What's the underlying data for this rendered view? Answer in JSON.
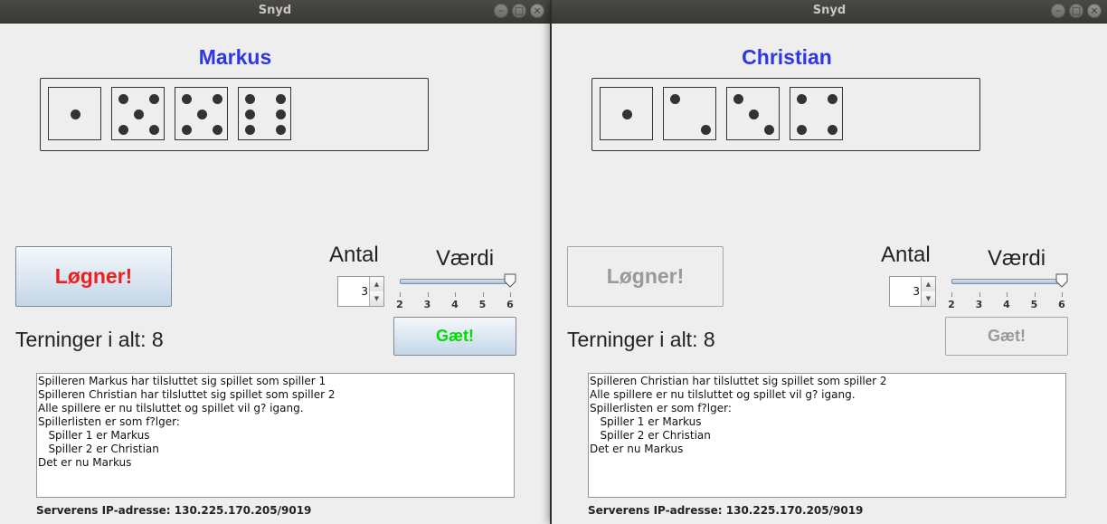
{
  "windows": [
    {
      "title": "Snyd",
      "player_name": "Markus",
      "dice": [
        1,
        5,
        5,
        6
      ],
      "liar_label": "Løgner!",
      "liar_enabled": true,
      "antal_label": "Antal",
      "antal_value": "3",
      "vaerdi_label": "Værdi",
      "slider_value": 6,
      "slider_ticks": [
        "2",
        "3",
        "4",
        "5",
        "6"
      ],
      "guess_label": "Gæt!",
      "guess_enabled": true,
      "total_dice_text": "Terninger i alt: 8",
      "log_lines": [
        "Spilleren Markus har tilsluttet sig spillet som spiller 1",
        "Spilleren Christian har tilsluttet sig spillet som spiller 2",
        "Alle spillere er nu tilsluttet og spillet vil g? igang.",
        "Spillerlisten er som f?lger:",
        "   Spiller 1 er Markus",
        "   Spiller 2 er Christian",
        "Det er nu Markus"
      ],
      "server_ip_text": "Serverens IP-adresse: 130.225.170.205/9019"
    },
    {
      "title": "Snyd",
      "player_name": "Christian",
      "dice": [
        1,
        2,
        3,
        4
      ],
      "liar_label": "Løgner!",
      "liar_enabled": false,
      "antal_label": "Antal",
      "antal_value": "3",
      "vaerdi_label": "Værdi",
      "slider_value": 6,
      "slider_ticks": [
        "2",
        "3",
        "4",
        "5",
        "6"
      ],
      "guess_label": "Gæt!",
      "guess_enabled": false,
      "total_dice_text": "Terninger i alt: 8",
      "log_lines": [
        "Spilleren Christian har tilsluttet sig spillet som spiller 2",
        "Alle spillere er nu tilsluttet og spillet vil g? igang.",
        "Spillerlisten er som f?lger:",
        "   Spiller 1 er Markus",
        "   Spiller 2 er Christian",
        "Det er nu Markus"
      ],
      "server_ip_text": "Serverens IP-adresse: 130.225.170.205/9019"
    }
  ],
  "colors": {
    "player_name": "#2f35e8",
    "liar_text": "#ee1f1f",
    "guess_text": "#00dd00",
    "disabled_text": "#999999",
    "titlebar": "#3c3b37"
  },
  "icons": {
    "minimize": "minimize-icon",
    "maximize": "maximize-icon",
    "close": "close-icon"
  }
}
